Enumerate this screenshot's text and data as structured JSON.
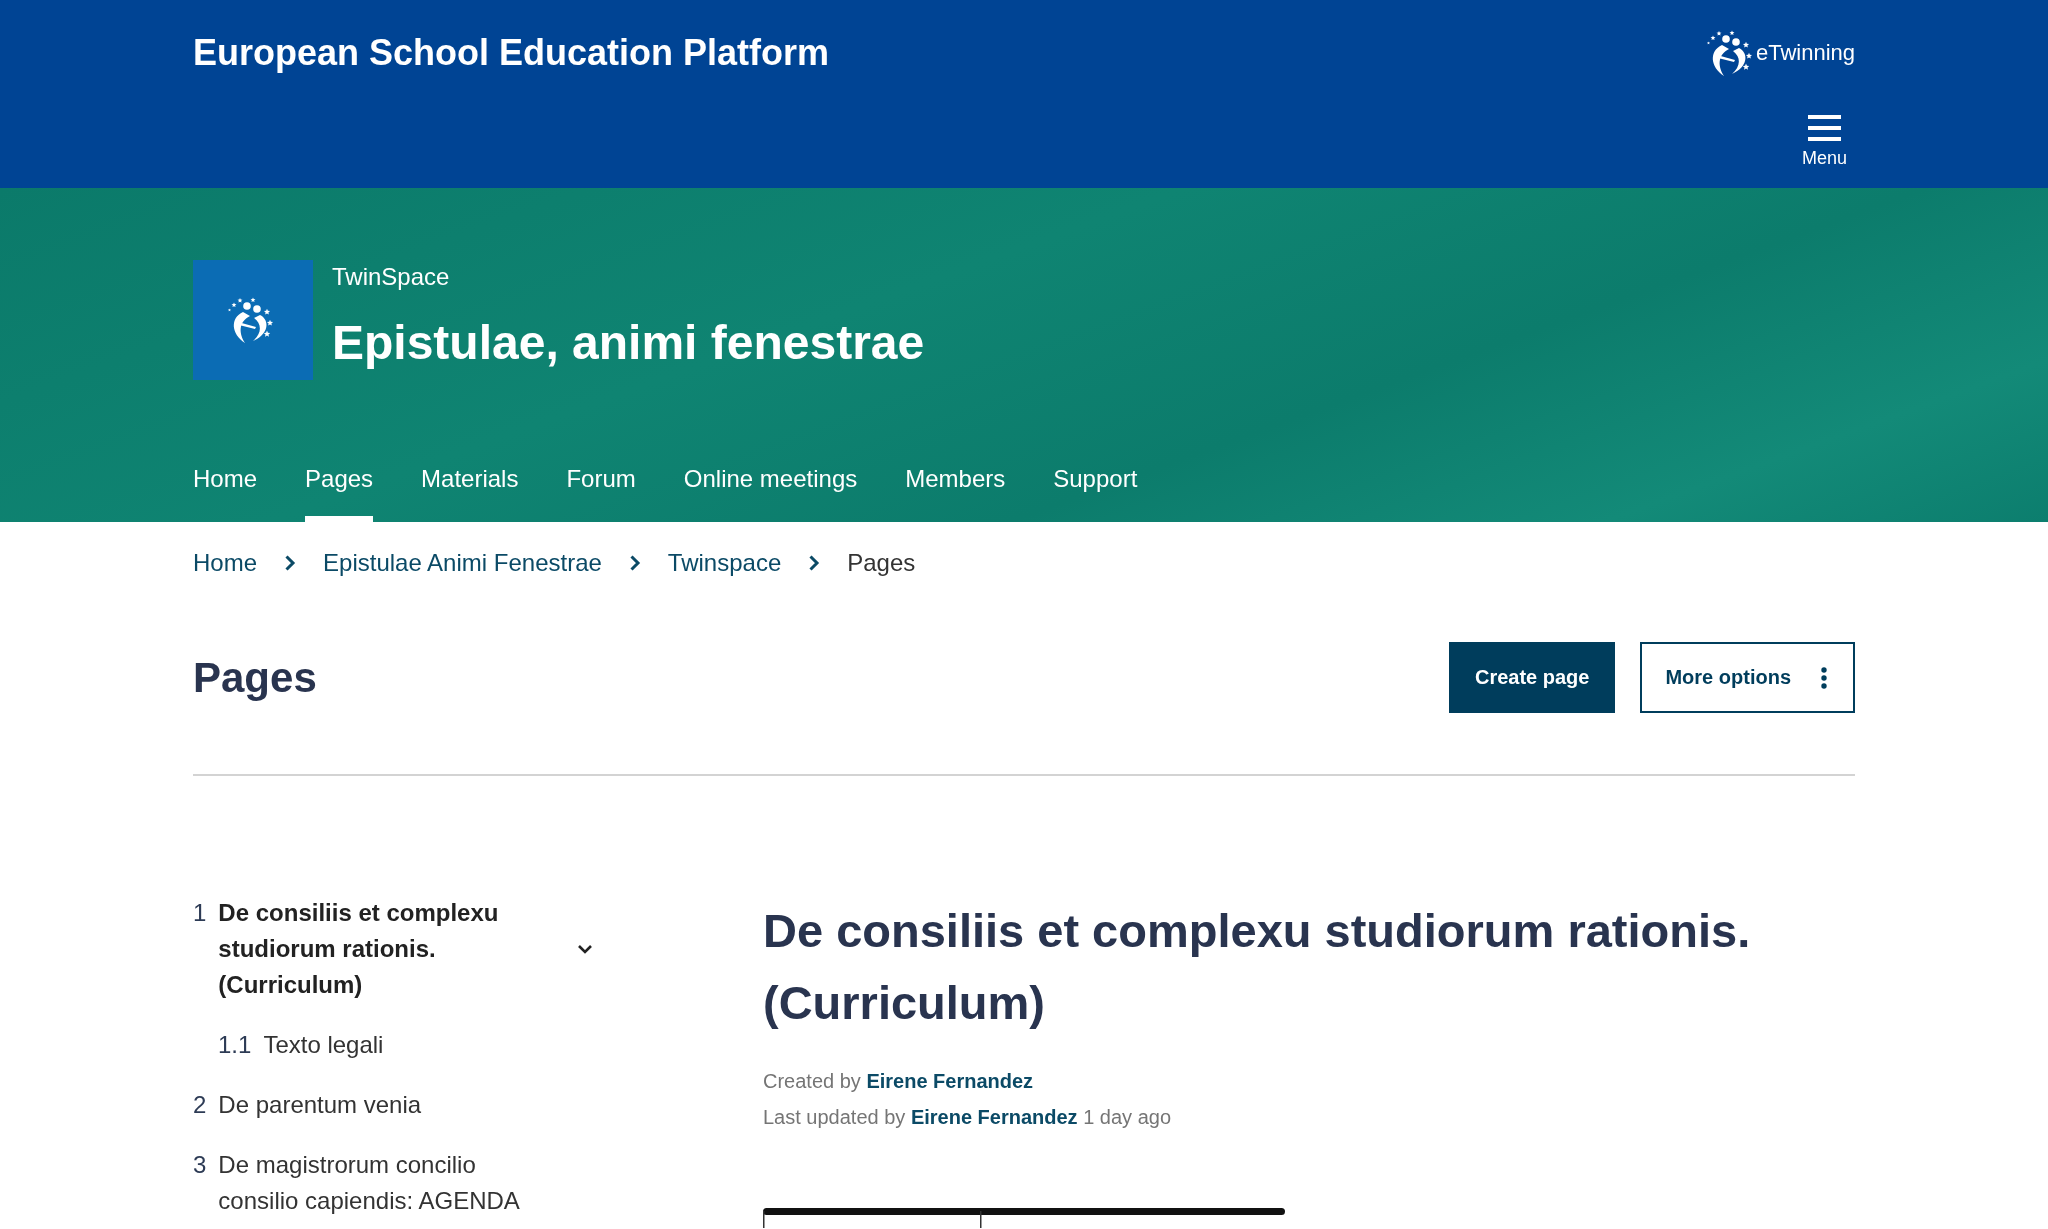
{
  "header": {
    "title": "European School Education Platform",
    "logo_text": "eTwinning",
    "menu_label": "Menu"
  },
  "space": {
    "label": "TwinSpace",
    "title": "Epistulae, animi fenestrae"
  },
  "tabs": [
    {
      "label": "Home",
      "selected": false
    },
    {
      "label": "Pages",
      "selected": true
    },
    {
      "label": "Materials",
      "selected": false
    },
    {
      "label": "Forum",
      "selected": false
    },
    {
      "label": "Online meetings",
      "selected": false
    },
    {
      "label": "Members",
      "selected": false
    },
    {
      "label": "Support",
      "selected": false
    }
  ],
  "breadcrumb": [
    {
      "label": "Home",
      "kind": "link"
    },
    {
      "label": "Epistulae Animi Fenestrae",
      "kind": "link"
    },
    {
      "label": "Twinspace",
      "kind": "link"
    },
    {
      "label": "Pages",
      "kind": "current"
    }
  ],
  "page": {
    "title": "Pages",
    "buttons": [
      {
        "label": "Create page",
        "kind": "primary"
      },
      {
        "label": "More options",
        "kind": "options"
      }
    ]
  },
  "page_tree": [
    {
      "number": "1",
      "title": "De consiliis et complexu studiorum rationis. (Curriculum)",
      "selected": true,
      "expanded": true,
      "children": [
        {
          "number": "1.1",
          "title": "Texto legali",
          "selected": false
        }
      ]
    },
    {
      "number": "2",
      "title": "De parentum venia",
      "selected": false
    },
    {
      "number": "3",
      "title": "De magistrorum concilio consilio capiendis: AGENDA",
      "selected": false
    }
  ],
  "article": {
    "title": "De consiliis et complexu studiorum rationis. (Curriculum)",
    "created": {
      "label": "Created by",
      "author": "Eirene Fernandez"
    },
    "updated": {
      "label": "Last updated by",
      "author": "Eirene Fernandez",
      "time": "1 day ago"
    }
  }
}
